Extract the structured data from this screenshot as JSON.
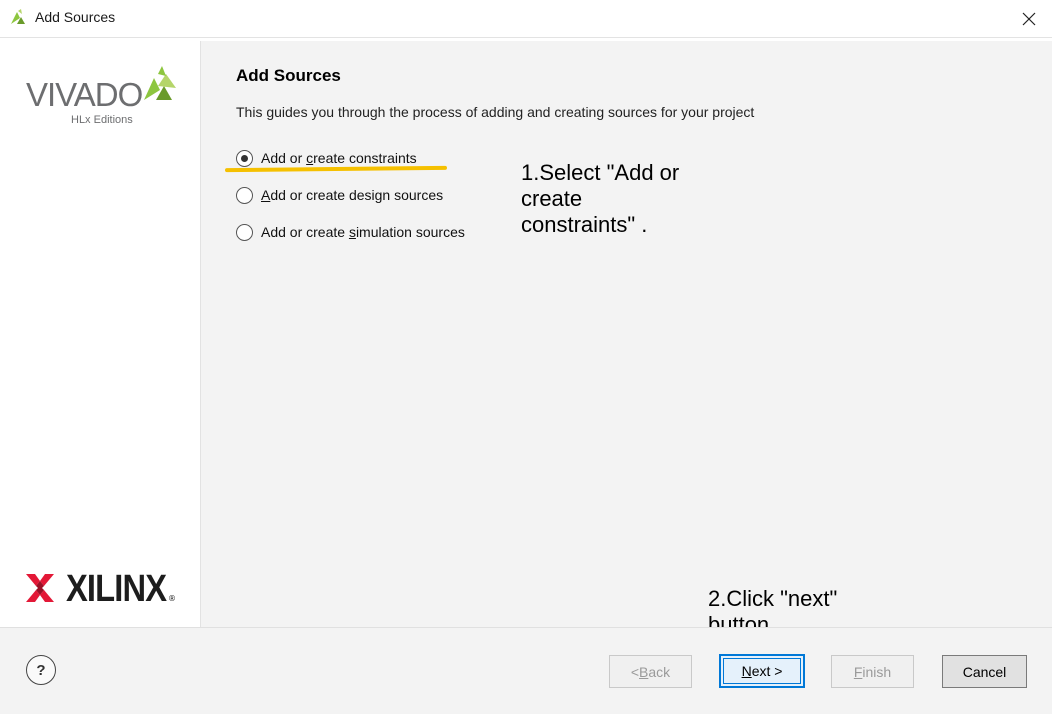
{
  "window": {
    "title": "Add Sources",
    "icon": "vivado-leaf-icon",
    "close_icon": "close-icon"
  },
  "sidebar": {
    "vivado_logo": {
      "word": "VIVADO",
      "sub": "HLx Editions"
    },
    "xilinx_logo": {
      "word": "XILINX",
      "reg": "®"
    }
  },
  "main": {
    "title": "Add Sources",
    "description": "This guides you through the process of adding and creating sources for your project",
    "options": [
      {
        "label_pre": "Add or ",
        "mnemonic": "c",
        "label_post": "reate constraints",
        "selected": true
      },
      {
        "label_pre": "",
        "mnemonic": "A",
        "label_post": "dd or create design sources",
        "selected": false
      },
      {
        "label_pre": "Add or create ",
        "mnemonic": "s",
        "label_post": "imulation sources",
        "selected": false
      }
    ]
  },
  "annotations": {
    "step1_line1": "1.Select \"Add or",
    "step1_line2": "create",
    "step1_line3": "constraints\" .",
    "step2_line1": "2.Click \"next\"",
    "step2_line2": "button.",
    "highlight_color": "#f5c000"
  },
  "footer": {
    "help_label": "?",
    "back": {
      "pre": "< ",
      "mnemonic": "B",
      "post": "ack",
      "enabled": false
    },
    "next": {
      "pre": "",
      "mnemonic": "N",
      "post": "ext >",
      "enabled": true
    },
    "finish": {
      "pre": "",
      "mnemonic": "F",
      "post": "inish",
      "enabled": false
    },
    "cancel": {
      "label": "Cancel",
      "enabled": true
    }
  },
  "colors": {
    "accent": "#0078d7",
    "panel_bg": "#f3f3f3",
    "vivado_green": "#8dc63f",
    "xilinx_red": "#e31837"
  }
}
